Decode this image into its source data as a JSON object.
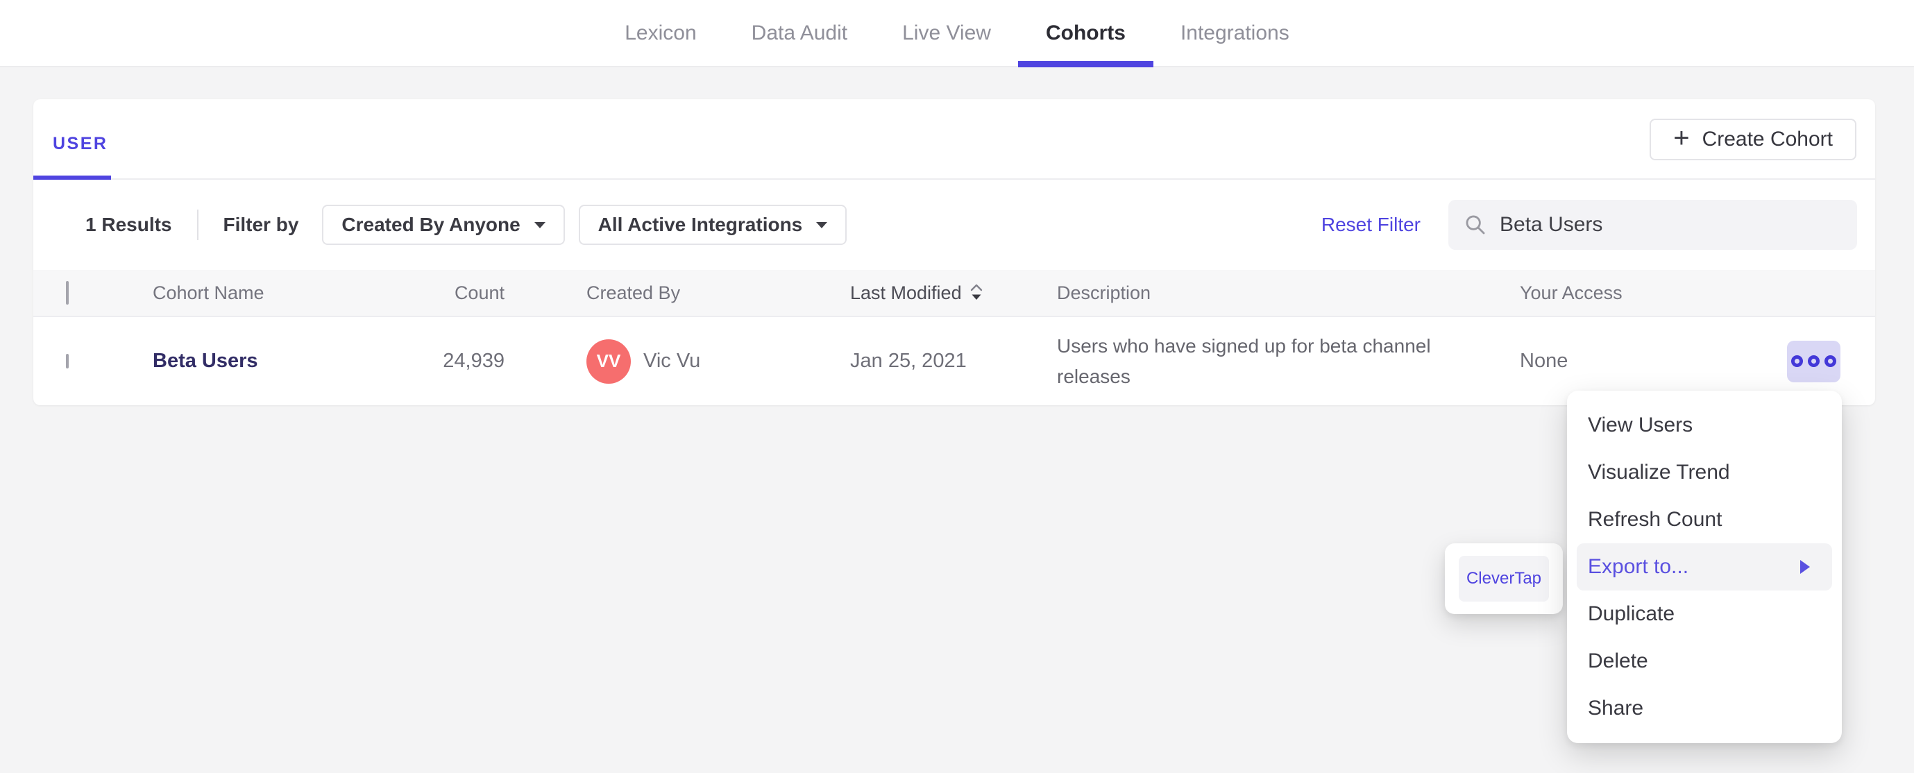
{
  "nav": {
    "tabs": [
      {
        "label": "Lexicon",
        "active": false
      },
      {
        "label": "Data Audit",
        "active": false
      },
      {
        "label": "Live View",
        "active": false
      },
      {
        "label": "Cohorts",
        "active": true
      },
      {
        "label": "Integrations",
        "active": false
      }
    ]
  },
  "card": {
    "user_tab_label": "USER",
    "create_button_label": "Create Cohort",
    "plus_glyph": "+"
  },
  "filters": {
    "results_text": "1 Results",
    "filter_by_label": "Filter by",
    "created_by_dropdown": {
      "value": "Created By Anyone"
    },
    "integrations_dropdown": {
      "value": "All Active Integrations"
    },
    "reset_label": "Reset Filter",
    "search": {
      "value": "Beta Users",
      "icon": "search-icon"
    }
  },
  "table": {
    "columns": {
      "name": "Cohort Name",
      "count": "Count",
      "created_by": "Created By",
      "last_modified": "Last Modified",
      "description": "Description",
      "your_access": "Your Access"
    },
    "rows": [
      {
        "name": "Beta Users",
        "count": "24,939",
        "avatar_initials": "VV",
        "created_by": "Vic Vu",
        "last_modified": "Jan 25, 2021",
        "description": "Users who have signed up for beta channel releases",
        "your_access": "None"
      }
    ]
  },
  "context_menu": {
    "items": [
      {
        "label": "View Users"
      },
      {
        "label": "Visualize Trend"
      },
      {
        "label": "Refresh Count"
      },
      {
        "label": "Export to...",
        "highlighted": true,
        "has_submenu": true
      },
      {
        "label": "Duplicate"
      },
      {
        "label": "Delete"
      },
      {
        "label": "Share"
      }
    ]
  },
  "export_submenu": {
    "items": [
      {
        "label": "CleverTap"
      }
    ]
  },
  "colors": {
    "accent": "#4f44e0",
    "avatar": "#f66e6e",
    "more_button_bg": "#d9d7f5",
    "menu_highlight_bg": "#f3f3f5",
    "cohort_link": "#322d66",
    "page_bg": "#f4f4f5"
  }
}
